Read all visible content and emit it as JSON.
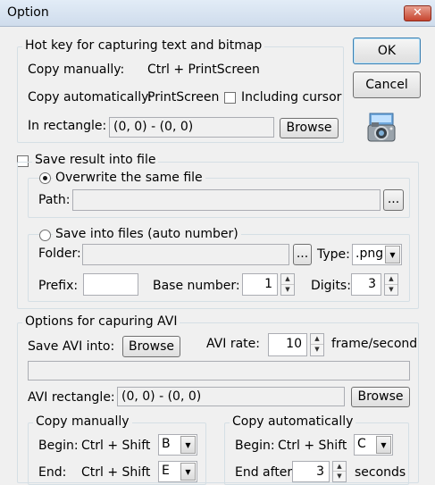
{
  "window": {
    "title": "Option",
    "close_label": "✕"
  },
  "buttons": {
    "ok": "OK",
    "cancel": "Cancel"
  },
  "hotkey": {
    "legend": "Hot key for capturing text and bitmap",
    "copy_manually_label": "Copy manually:",
    "copy_manually_value": "Ctrl + PrintScreen",
    "copy_auto_label": "Copy automatically:",
    "copy_auto_value": "PrintScreen",
    "including_cursor": "Including cursor",
    "rect_label": "In rectangle:",
    "rect_value": "(0, 0) - (0, 0)",
    "browse": "Browse"
  },
  "save": {
    "legend": "Save result into file",
    "overwrite_legend": "Overwrite the same file",
    "path_label": "Path:",
    "path_value": "",
    "dots": "...",
    "auto_legend": "Save into files (auto number)",
    "folder_label": "Folder:",
    "folder_value": "",
    "type_label": "Type:",
    "type_value": ".png",
    "prefix_label": "Prefix:",
    "prefix_value": "",
    "base_label": "Base number:",
    "base_value": "1",
    "digits_label": "Digits:",
    "digits_value": "3"
  },
  "avi": {
    "legend": "Options for capuring AVI",
    "save_into_label": "Save AVI into:",
    "browse": "Browse",
    "rate_label": "AVI rate:",
    "rate_value": "10",
    "rate_unit": "frame/second",
    "path_value": "",
    "rect_label": "AVI rectangle:",
    "rect_value": "(0, 0) - (0, 0)",
    "rect_browse": "Browse",
    "manual_legend": "Copy manually",
    "manual_begin_label": "Begin:",
    "manual_begin_keys": "Ctrl + Shift",
    "manual_begin_value": "B",
    "manual_end_label": "End:",
    "manual_end_keys": "Ctrl + Shift",
    "manual_end_value": "E",
    "auto_legend": "Copy automatically",
    "auto_begin_label": "Begin:",
    "auto_begin_keys": "Ctrl + Shift",
    "auto_begin_value": "C",
    "auto_end_label": "End after",
    "auto_end_value": "3",
    "auto_end_unit": "seconds"
  },
  "icons": {
    "camera": "camera-icon",
    "dropdown": "chevron-down-icon",
    "spin": "spin-arrows-icon"
  }
}
